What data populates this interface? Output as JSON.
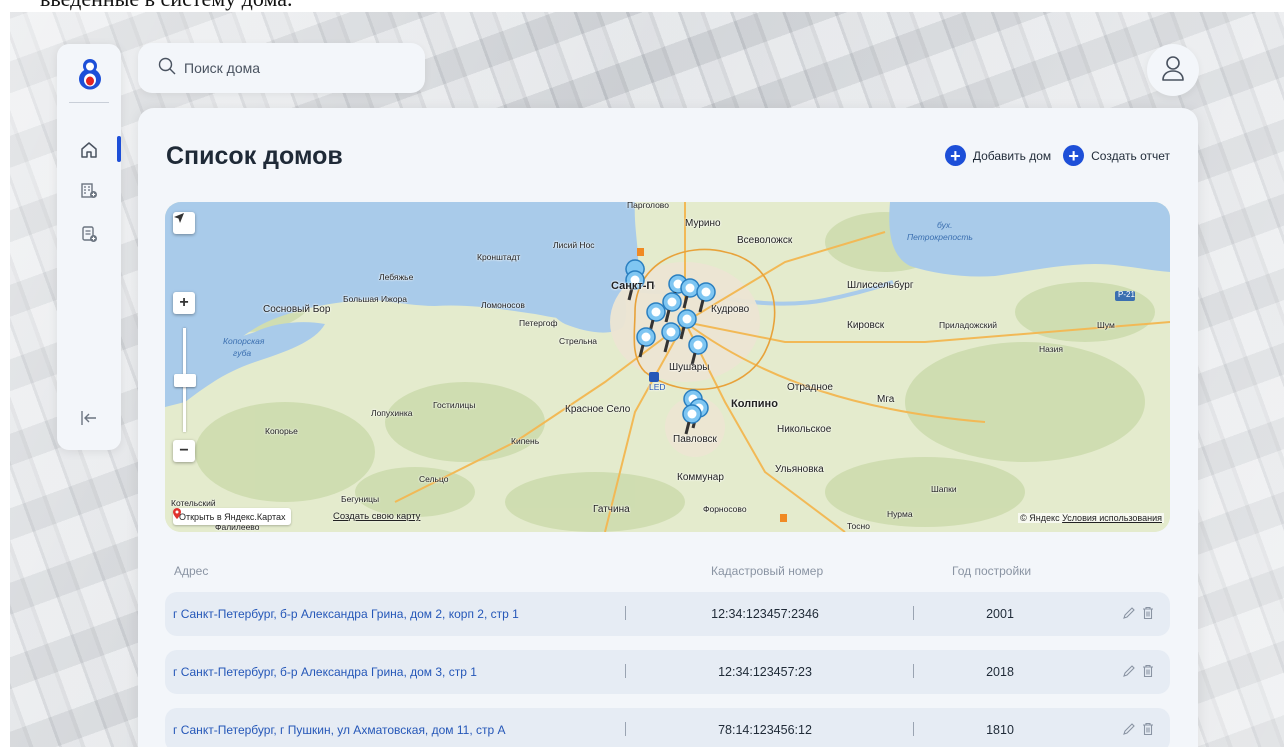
{
  "caption": "введенные в систему дома.",
  "search": {
    "placeholder": "Поиск дома"
  },
  "sidebar": {
    "items": [
      {
        "icon": "home-icon"
      },
      {
        "icon": "building-add-icon"
      },
      {
        "icon": "report-add-icon"
      }
    ],
    "logout_icon": "logout-icon"
  },
  "page": {
    "title": "Список домов"
  },
  "actions": {
    "add_house": "Добавить дом",
    "create_report": "Создать отчет"
  },
  "map": {
    "open_in_yandex": "Открыть в Яндекс.Картах",
    "create_map": "Создать свою карту",
    "copyright_prefix": "© Яндекс",
    "terms": "Условия использования",
    "labels": {
      "pargolovo": "Парголово",
      "murino": "Мурино",
      "vsevolozhsk": "Всеволожск",
      "bay": "бух.",
      "bay2": "Петрокрепость",
      "lisiy_nos": "Лисий Нос",
      "kronshtadt": "Кронштадт",
      "lebyazhye": "Лебяжье",
      "bolshaya_izhora": "Большая Ижора",
      "sosnovy_bor": "Сосновый Бор",
      "lomonosov": "Ломоносов",
      "peterhof": "Петергоф",
      "strelna": "Стрельна",
      "spb": "Санкт-Петербург",
      "kudrovo": "Кудрово",
      "shlisselburg": "Шлиссельбург",
      "kirovsk": "Кировск",
      "priladozhsky": "Приладожский",
      "shum": "Шум",
      "nazia": "Назия",
      "p21": "Р-21",
      "koporskaya": "Копорская",
      "guba": "губа",
      "shushary": "Шушары",
      "led": "LED",
      "otradnoe": "Отрадное",
      "mga": "Мга",
      "kolpino": "Колпино",
      "gostilitsy": "Гостилицы",
      "lopukhinka": "Лопухинка",
      "krasnoe_selo": "Красное Село",
      "koporye": "Копорье",
      "kipen": "Кипень",
      "pavlovsk": "Павловск",
      "nikolskoe": "Никольское",
      "ulyanovka": "Ульяновка",
      "selco": "Сельцо",
      "kommunar": "Коммунар",
      "shapki": "Шапки",
      "kotelsky": "Котельский",
      "begunitsy": "Бегуницы",
      "falileevo": "Фалилеево",
      "gatchina": "Гатчина",
      "fornosovo": "Форносово",
      "nurma": "Нурма",
      "tosno": "Тосно"
    }
  },
  "table": {
    "headers": {
      "address": "Адрес",
      "cadastral": "Кадастровый номер",
      "year": "Год постройки"
    },
    "rows": [
      {
        "address": "г Санкт-Петербург, б-р Александра Грина, дом 2, корп 2, стр 1",
        "cadastral": "12:34:123457:2346",
        "year": "2001"
      },
      {
        "address": "г Санкт-Петербург, б-р Александра Грина, дом 3, стр 1",
        "cadastral": "12:34:123457:23",
        "year": "2018"
      },
      {
        "address": "г Санкт-Петербург, г Пушкин, ул Ахматовская, дом 11, стр А",
        "cadastral": "78:14:123456:12",
        "year": "1810"
      }
    ]
  },
  "colors": {
    "accent": "#1d4fd8",
    "panel": "#f3f6fa",
    "row": "#e6ecf4",
    "link": "#2557b8",
    "water": "#a9cbea",
    "land": "#dfe9c9"
  }
}
